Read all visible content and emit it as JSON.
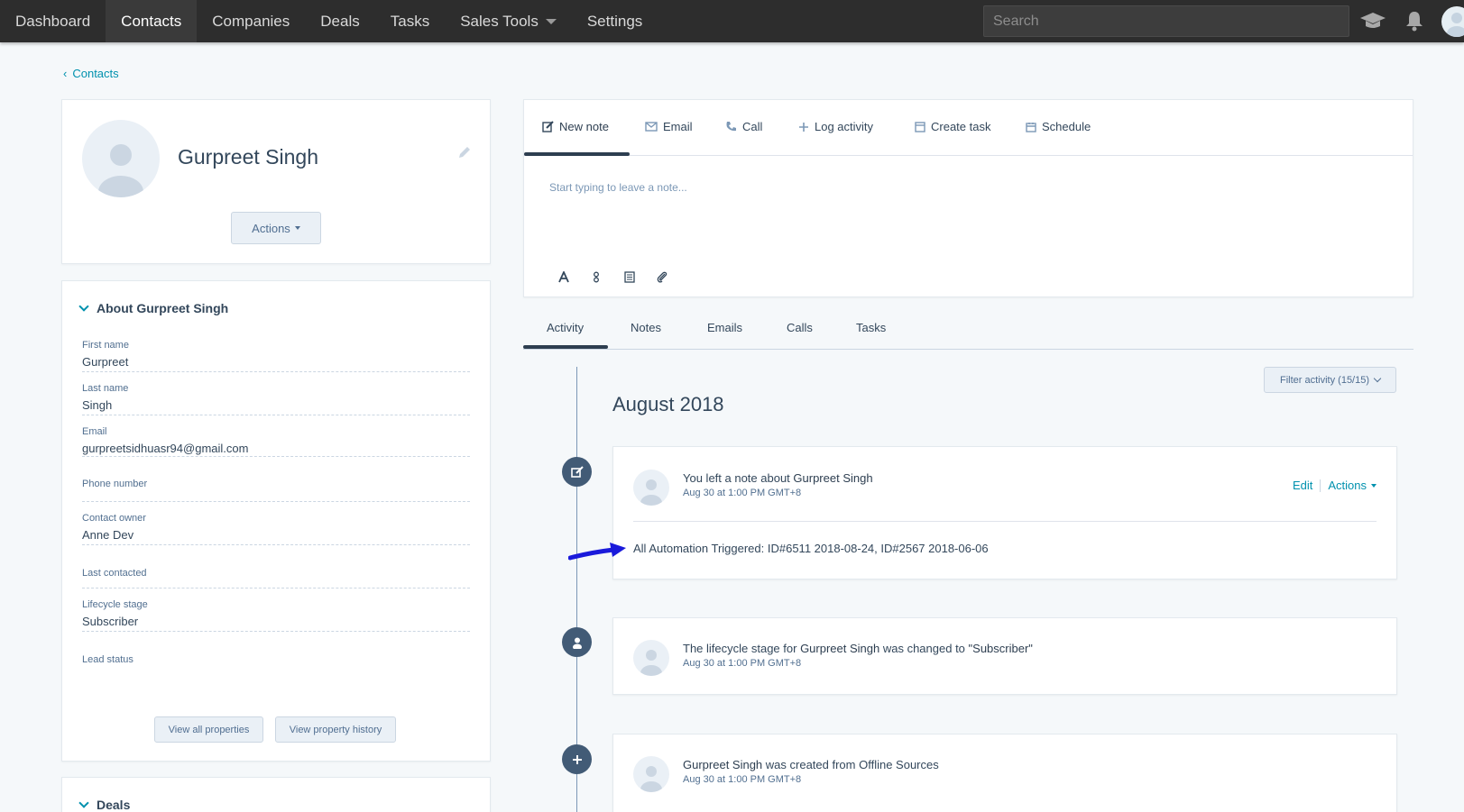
{
  "nav": {
    "items": [
      {
        "label": "Dashboard"
      },
      {
        "label": "Contacts"
      },
      {
        "label": "Companies"
      },
      {
        "label": "Deals"
      },
      {
        "label": "Tasks"
      },
      {
        "label": "Sales Tools"
      },
      {
        "label": "Settings"
      }
    ],
    "active": "Contacts",
    "search_placeholder": "Search",
    "icons": [
      "graduation-cap-icon",
      "bell-icon",
      "avatar"
    ]
  },
  "breadcrumb": {
    "label": "Contacts"
  },
  "profile": {
    "name": "Gurpreet Singh",
    "actions_label": "Actions"
  },
  "about": {
    "title": "About Gurpreet Singh",
    "properties": [
      {
        "label": "First name",
        "value": "Gurpreet"
      },
      {
        "label": "Last name",
        "value": "Singh"
      },
      {
        "label": "Email",
        "value": "gurpreetsidhuasr94@gmail.com"
      },
      {
        "label": "Phone number",
        "value": ""
      },
      {
        "label": "Contact owner",
        "value": "Anne Dev"
      },
      {
        "label": "Last contacted",
        "value": ""
      },
      {
        "label": "Lifecycle stage",
        "value": "Subscriber"
      },
      {
        "label": "Lead status",
        "value": ""
      }
    ],
    "view_all_label": "View all properties",
    "view_history_label": "View property history"
  },
  "deals": {
    "title": "Deals"
  },
  "composer": {
    "tabs": [
      {
        "label": "New note",
        "icon": "pencil-square-icon"
      },
      {
        "label": "Email",
        "icon": "envelope-icon"
      },
      {
        "label": "Call",
        "icon": "phone-icon"
      },
      {
        "label": "Log activity",
        "icon": "plus-icon"
      },
      {
        "label": "Create task",
        "icon": "task-icon"
      },
      {
        "label": "Schedule",
        "icon": "calendar-icon"
      }
    ],
    "placeholder": "Start typing to leave a note...",
    "toolbar_icons": [
      "text-format-icon",
      "personalize-icon",
      "snippet-icon",
      "attachment-icon"
    ]
  },
  "activity_tabs": [
    {
      "label": "Activity"
    },
    {
      "label": "Notes"
    },
    {
      "label": "Emails"
    },
    {
      "label": "Calls"
    },
    {
      "label": "Tasks"
    }
  ],
  "filter": {
    "label": "Filter activity (15/15)"
  },
  "timeline": {
    "month": "August 2018",
    "note": {
      "title_prefix": "You left a note about ",
      "title_name": "Gurpreet Singh",
      "time": "Aug 30 at 1:00 PM GMT+8",
      "edit_label": "Edit",
      "actions_label": "Actions",
      "body": "All Automation Triggered: ID#6511 2018-08-24, ID#2567 2018-06-06"
    },
    "lifecycle": {
      "prefix": "The lifecycle stage for ",
      "name": "Gurpreet Singh",
      "middle": " was changed to ",
      "stage": "\"Subscriber\"",
      "time": "Aug 30 at 1:00 PM GMT+8"
    },
    "created": {
      "name": "Gurpreet Singh",
      "suffix": " was created from Offline Sources",
      "time": "Aug 30 at 1:00 PM GMT+8"
    }
  },
  "colors": {
    "nav_bg": "#2d2d2d",
    "accent_link": "#0091ae",
    "timeline_node": "#425b76",
    "annotation_arrow": "#1a1adb"
  }
}
